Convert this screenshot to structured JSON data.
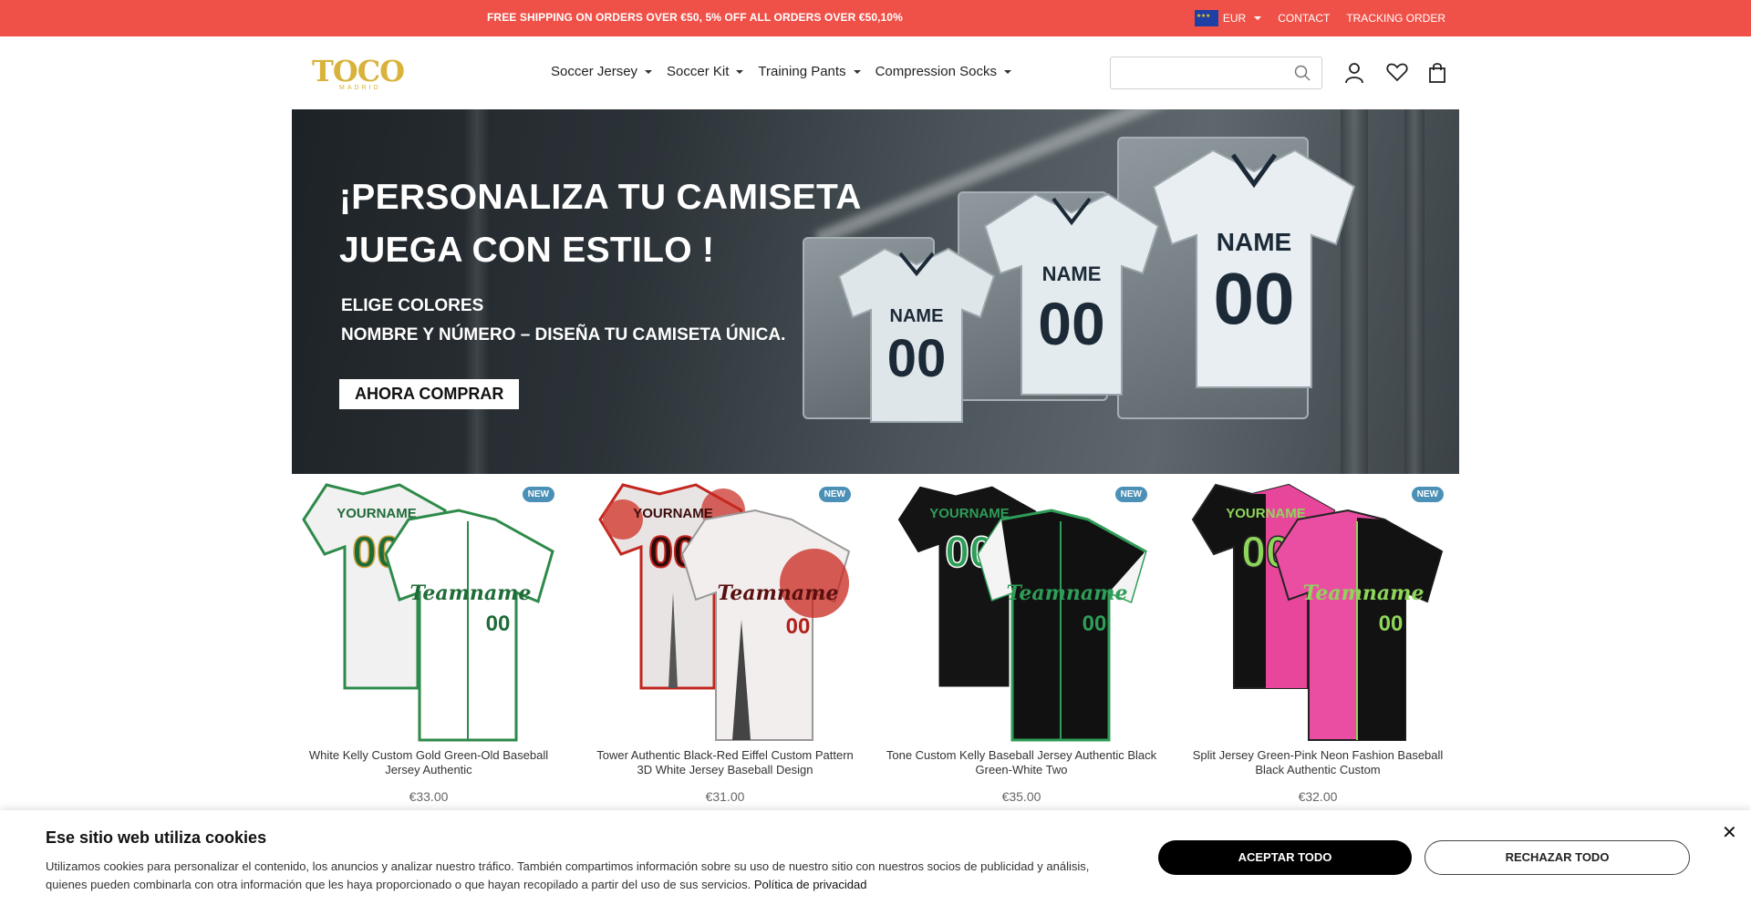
{
  "topbar": {
    "promo": "FREE SHIPPING ON ORDERS OVER €50, 5% OFF ALL ORDERS OVER €50,10%",
    "currency": "EUR",
    "contact": "CONTACT",
    "tracking": "TRACKING ORDER",
    "color": "#ef5148"
  },
  "header": {
    "logo_word": "TOCO",
    "logo_sub": "MADRID",
    "nav": [
      {
        "label": "Soccer Jersey"
      },
      {
        "label": "Soccer Kit"
      },
      {
        "label": "Training Pants"
      },
      {
        "label": "Compression Socks"
      }
    ],
    "search_placeholder": "",
    "icons": [
      "search-icon",
      "account-icon",
      "wishlist-icon",
      "cart-icon"
    ]
  },
  "hero": {
    "title_line1": "¡PERSONALIZA TU CAMISETA",
    "title_line2": "JUEGA CON ESTILO !",
    "sub_line1": "ELIGE COLORES",
    "sub_line2": "NOMBRE Y NÚMERO – DISEÑA TU CAMISETA ÚNICA.",
    "cta": "AHORA COMPRAR",
    "jersey_name": "NAME",
    "jersey_number": "00"
  },
  "products": [
    {
      "name": "White Kelly Custom Gold Green-Old Baseball Jersey Authentic",
      "price": "€33.00",
      "badge": "NEW",
      "front_name": "YOURNAME",
      "back_name": "Teamname",
      "number": "00"
    },
    {
      "name": "Tower Authentic Black-Red Eiffel Custom Pattern 3D White Jersey Baseball Design",
      "price": "€31.00",
      "badge": "NEW",
      "front_name": "YOURNAME",
      "back_name": "Teamname",
      "number": "00"
    },
    {
      "name": "Tone Custom Kelly Baseball Jersey Authentic Black Green-White Two",
      "price": "€35.00",
      "badge": "NEW",
      "front_name": "YOURNAME",
      "back_name": "Teamname",
      "number": "00"
    },
    {
      "name": "Split Jersey Green-Pink Neon Fashion Baseball Black Authentic Custom",
      "price": "€32.00",
      "badge": "NEW",
      "front_name": "YOURNAME",
      "back_name": "Teamname",
      "number": "00"
    }
  ],
  "cookie": {
    "title": "Ese sitio web utiliza cookies",
    "text_line1": "Utilizamos cookies para personalizar el contenido, los anuncios y analizar nuestro tráfico. También compartimos información sobre su uso de nuestro sitio con nuestros socios de publicidad y análisis,",
    "text_line2": "quienes pueden combinarla con otra información que les haya proporcionado o que hayan recopilado a partir del uso de sus servicios.",
    "policy_link": "Política de privacidad",
    "accept": "ACEPTAR TODO",
    "reject": "RECHAZAR TODO",
    "close": "✕"
  }
}
